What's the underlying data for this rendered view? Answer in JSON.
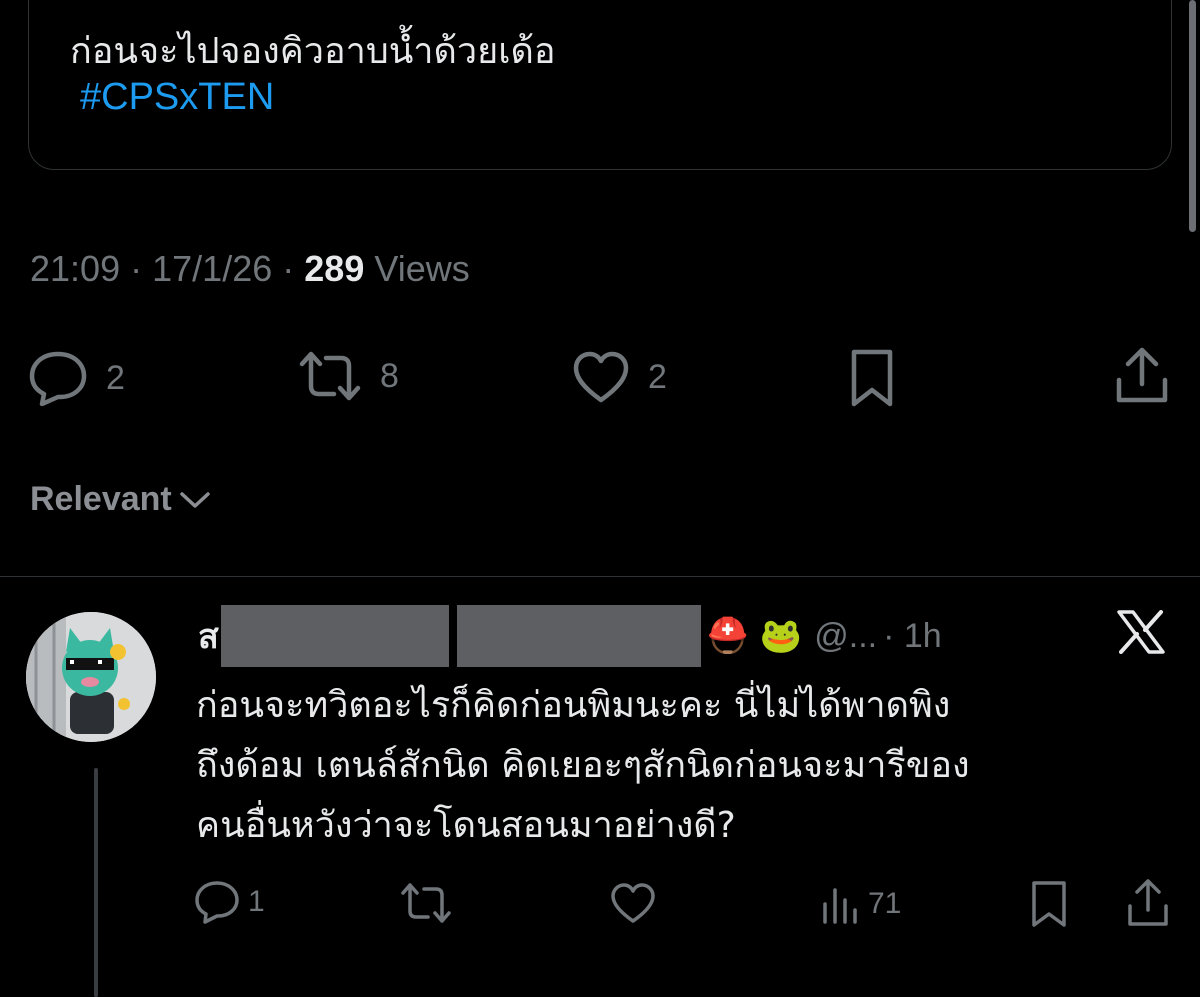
{
  "tweet": {
    "body_text": "ก่อนจะไปจองคิวอาบน้ำด้วยเด้อ",
    "hashtag": "#CPSxTEN",
    "time": "21:09",
    "date": "17/1/26",
    "views_count": "289",
    "views_label": "Views",
    "separator": "·",
    "actions": {
      "replies": "2",
      "reposts": "8",
      "likes": "2"
    }
  },
  "sort": {
    "label": "Relevant"
  },
  "reply": {
    "name_visible": "ส",
    "emojis": "⛑️ 🐸",
    "handle": "@...",
    "time_ago": "· 1h",
    "text_lines": [
      "ก่อนจะทวิตอะไรก็คิดก่อนพิมนะคะ นี่ไม่ได้พาดพิง",
      "ถึงด้อม เตนล์สักนิด คิดเยอะๆสักนิดก่อนจะมารีของ",
      "คนอื่นหวังว่าจะโดนสอนมาอย่างดี?"
    ],
    "actions": {
      "replies": "1",
      "views": "71"
    }
  },
  "colors": {
    "background": "#000000",
    "text": "#e7e9ea",
    "muted": "#71767b",
    "link": "#1d9bf0",
    "border": "#2f3336"
  }
}
